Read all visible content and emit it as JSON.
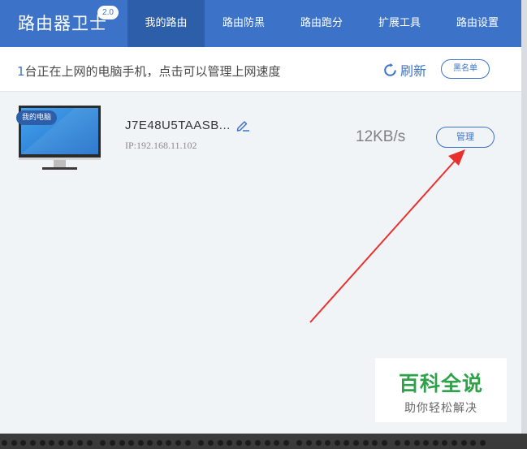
{
  "header": {
    "app_name": "路由器卫士",
    "version": "2.0",
    "tabs": [
      {
        "label": "我的路由",
        "active": true
      },
      {
        "label": "路由防黑",
        "active": false
      },
      {
        "label": "路由跑分",
        "active": false
      },
      {
        "label": "扩展工具",
        "active": false
      },
      {
        "label": "路由设置",
        "active": false
      }
    ]
  },
  "toolbar": {
    "online_count": "1",
    "online_text": "台正在上网的电脑手机，点击可以管理上网速度",
    "refresh_label": "刷新",
    "blacklist_label": "黑名单"
  },
  "devices": [
    {
      "tag": "我的电脑",
      "name": "J7E48U5TAASB...",
      "ip": "IP:192.168.11.102",
      "speed": "12KB/s",
      "manage_label": "管理"
    }
  ],
  "watermark": {
    "title": "百科全说",
    "subtitle": "助你轻松解决"
  },
  "colors": {
    "brand": "#3c73c9",
    "active_tab": "#2d5ea9",
    "annotation_arrow": "#e8312e",
    "watermark_green": "#2fa14a"
  },
  "icons": [
    "refresh-icon",
    "edit-icon",
    "monitor-icon",
    "annotation-arrow"
  ]
}
